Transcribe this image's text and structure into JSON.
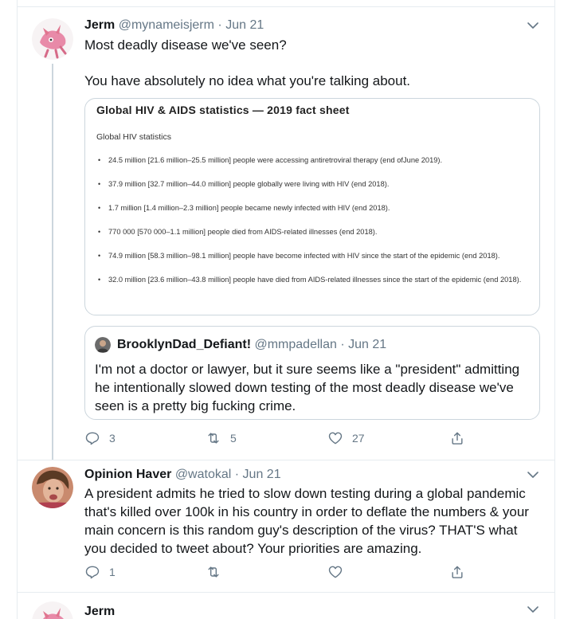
{
  "tweet1": {
    "name": "Jerm",
    "handle": "@mynameisjerm",
    "dot": "·",
    "date": "Jun 21",
    "line1": "Most deadly disease we've seen?",
    "line2": "You have absolutely no idea what you're talking about.",
    "card": {
      "title": "Global HIV & AIDS statistics — 2019 fact sheet",
      "subtitle": "Global HIV statistics",
      "items": [
        "24.5 million [21.6 million–25.5 million] people were accessing antiretroviral therapy (end ofJune 2019).",
        "37.9 million [32.7 million–44.0 million] people globally were living with HIV (end 2018).",
        "1.7 million [1.4 million–2.3 million] people became newly infected with HIV (end 2018).",
        "770 000 [570 000–1.1 million] people died from AIDS-related illnesses (end 2018).",
        "74.9 million [58.3 million–98.1 million] people have become infected with HIV since the start of the epidemic (end 2018).",
        "32.0 million [23.6 million–43.8 million] people have died from AIDS-related illnesses since the start of the epidemic (end 2018)."
      ]
    },
    "quote": {
      "name": "BrooklynDad_Defiant!",
      "handle": "@mmpadellan",
      "dot": "·",
      "date": "Jun 21",
      "text": "I'm not a doctor or lawyer, but it sure seems like a \"president\" admitting he intentionally slowed down testing of the most deadly disease we've seen is a pretty big fucking crime."
    },
    "actions": {
      "replies": "3",
      "retweets": "5",
      "likes": "27"
    }
  },
  "tweet2": {
    "name": "Opinion Haver",
    "handle": "@watokal",
    "dot": "·",
    "date": "Jun 21",
    "text": "A president admits he tried to slow down testing during a global pandemic that's killed over 100k in his country in order to deflate the numbers & your main concern is this random guy's description of the virus? THAT'S what you decided to tweet about? Your priorities are amazing.",
    "actions": {
      "replies": "1",
      "retweets": "",
      "likes": ""
    }
  },
  "tweet3": {
    "name": "Jerm"
  },
  "colors": {
    "text": "#14171a",
    "secondary": "#657786",
    "border": "#ccd6dd",
    "divider": "#e6ecf0"
  },
  "icons": [
    "reply-icon",
    "retweet-icon",
    "like-icon",
    "share-icon",
    "chevron-down-icon"
  ]
}
